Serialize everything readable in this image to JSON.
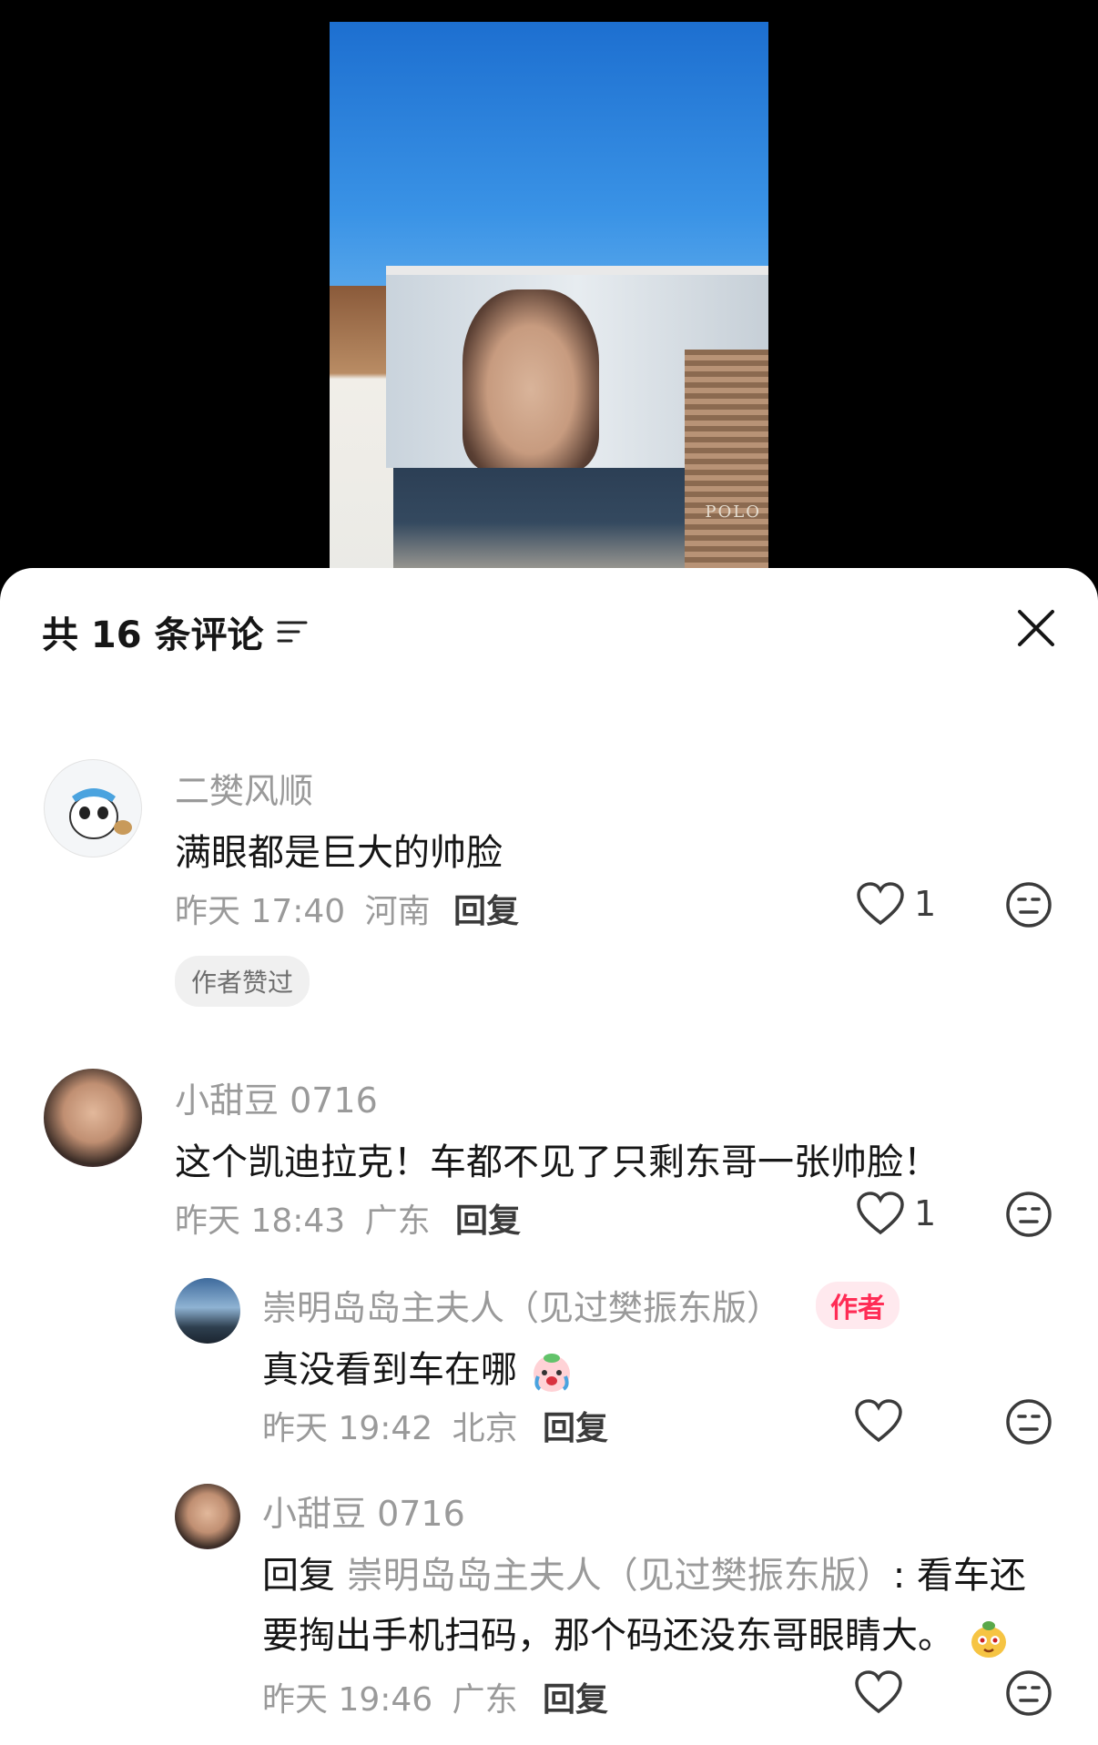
{
  "header": {
    "title": "共 16 条评论"
  },
  "video": {
    "sign_text": "POLO"
  },
  "comments": [
    {
      "username": "二樊风顺",
      "text": "满眼都是巨大的帅脸",
      "time": "昨天 17:40",
      "location": "河南",
      "reply_label": "回复",
      "likes": "1",
      "badge": "作者赞过"
    },
    {
      "username": "小甜豆 0716",
      "text": "这个凯迪拉克！车都不见了只剩东哥一张帅脸！",
      "time": "昨天 18:43",
      "location": "广东",
      "reply_label": "回复",
      "likes": "1",
      "replies": [
        {
          "username": "崇明岛岛主夫人（见过樊振东版）",
          "author_badge": "作者",
          "text": "真没看到车在哪",
          "time": "昨天 19:42",
          "location": "北京",
          "reply_label": "回复"
        },
        {
          "username": "小甜豆 0716",
          "reply_prefix": "回复",
          "reply_target": "崇明岛岛主夫人（见过樊振东版）",
          "text_line1": ": 看车还",
          "text_line2": "要掏出手机扫码，那个码还没东哥眼睛大。",
          "time": "昨天 19:46",
          "location": "广东",
          "reply_label": "回复"
        }
      ]
    }
  ]
}
